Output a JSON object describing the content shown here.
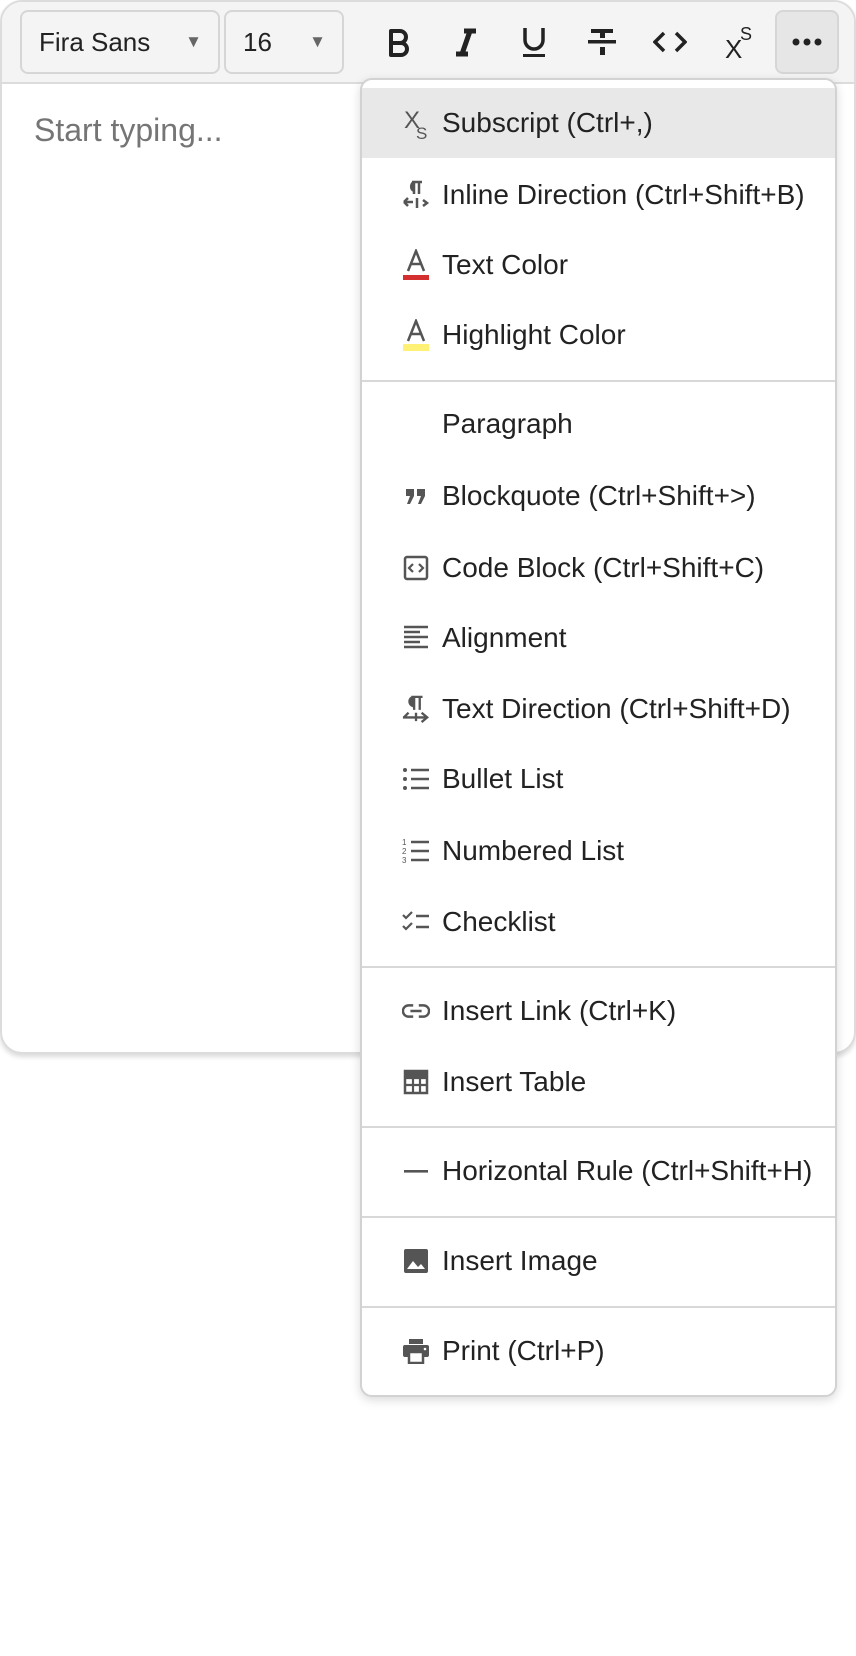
{
  "toolbar": {
    "font_family": "Fira Sans",
    "font_size": "16",
    "buttons": [
      {
        "name": "bold",
        "icon": "bold-icon"
      },
      {
        "name": "italic",
        "icon": "italic-icon"
      },
      {
        "name": "underline",
        "icon": "underline-icon"
      },
      {
        "name": "strikethrough",
        "icon": "strikethrough-icon"
      },
      {
        "name": "code",
        "icon": "code-icon"
      },
      {
        "name": "superscript",
        "icon": "superscript-icon"
      },
      {
        "name": "more",
        "icon": "more-icon"
      }
    ]
  },
  "editor": {
    "placeholder": "Start typing..."
  },
  "menu": {
    "items": [
      {
        "label": "Subscript (Ctrl+,)",
        "icon": "subscript-icon",
        "highlighted": true
      },
      {
        "label": "Inline Direction (Ctrl+Shift+B)",
        "icon": "inline-direction-icon"
      },
      {
        "label": "Text Color",
        "icon": "text-color-icon"
      },
      {
        "label": "Highlight Color",
        "icon": "highlight-color-icon"
      },
      {
        "label": "Paragraph",
        "icon": ""
      },
      {
        "label": "Blockquote (Ctrl+Shift+>)",
        "icon": "blockquote-icon"
      },
      {
        "label": "Code Block (Ctrl+Shift+C)",
        "icon": "code-block-icon"
      },
      {
        "label": "Alignment",
        "icon": "align-left-icon"
      },
      {
        "label": "Text Direction (Ctrl+Shift+D)",
        "icon": "text-direction-icon"
      },
      {
        "label": "Bullet List",
        "icon": "bullet-list-icon"
      },
      {
        "label": "Numbered List",
        "icon": "numbered-list-icon"
      },
      {
        "label": "Checklist",
        "icon": "checklist-icon"
      },
      {
        "label": "Insert Link (Ctrl+K)",
        "icon": "link-icon"
      },
      {
        "label": "Insert Table",
        "icon": "table-icon"
      },
      {
        "label": "Horizontal Rule (Ctrl+Shift+H)",
        "icon": "horizontal-rule-icon"
      },
      {
        "label": "Insert Image",
        "icon": "image-icon"
      },
      {
        "label": "Print (Ctrl+P)",
        "icon": "print-icon"
      }
    ]
  },
  "colors": {
    "text_color_swatch": "#d32f2f",
    "highlight_color_swatch": "#fff176",
    "menu_highlight": "#e8e8e8",
    "icon_gray": "#555555"
  }
}
